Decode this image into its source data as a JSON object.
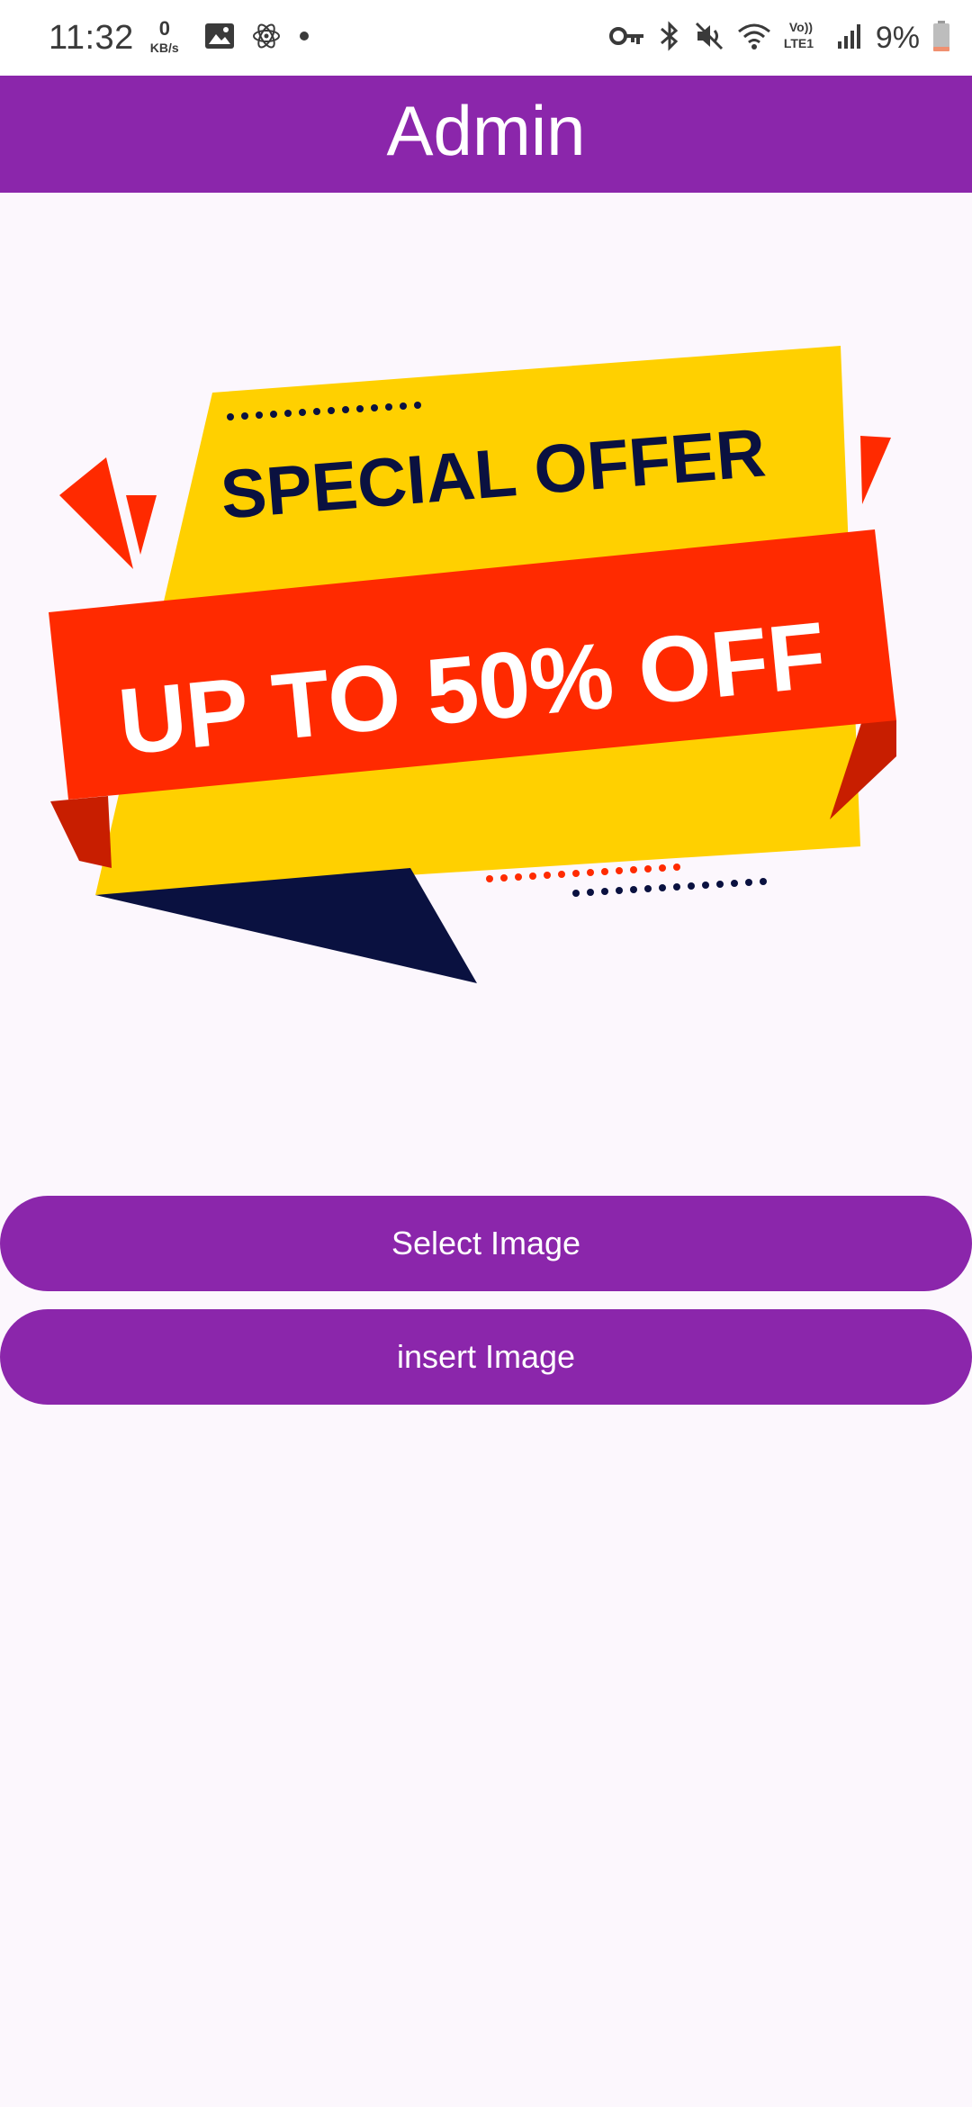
{
  "status_bar": {
    "time": "11:32",
    "data_speed_value": "0",
    "data_speed_unit": "KB/s",
    "volte_top": "Vo))",
    "volte_bottom": "LTE1",
    "battery": "9%",
    "icons": [
      "gallery-icon",
      "atom-icon",
      "dot-icon",
      "key-icon",
      "bluetooth-icon",
      "mute-icon",
      "wifi-icon",
      "signal-icon",
      "battery-icon"
    ]
  },
  "app_bar": {
    "title": "Admin",
    "color": "#8B26AB"
  },
  "banner": {
    "headline": "SPECIAL OFFER",
    "offer": "UP TO 50% OFF",
    "colors": {
      "yellow": "#FFD000",
      "red": "#FF2A00",
      "dark_red": "#C81E00",
      "navy": "#0A1140"
    }
  },
  "buttons": {
    "select_label": "Select Image",
    "insert_label": "insert Image"
  }
}
